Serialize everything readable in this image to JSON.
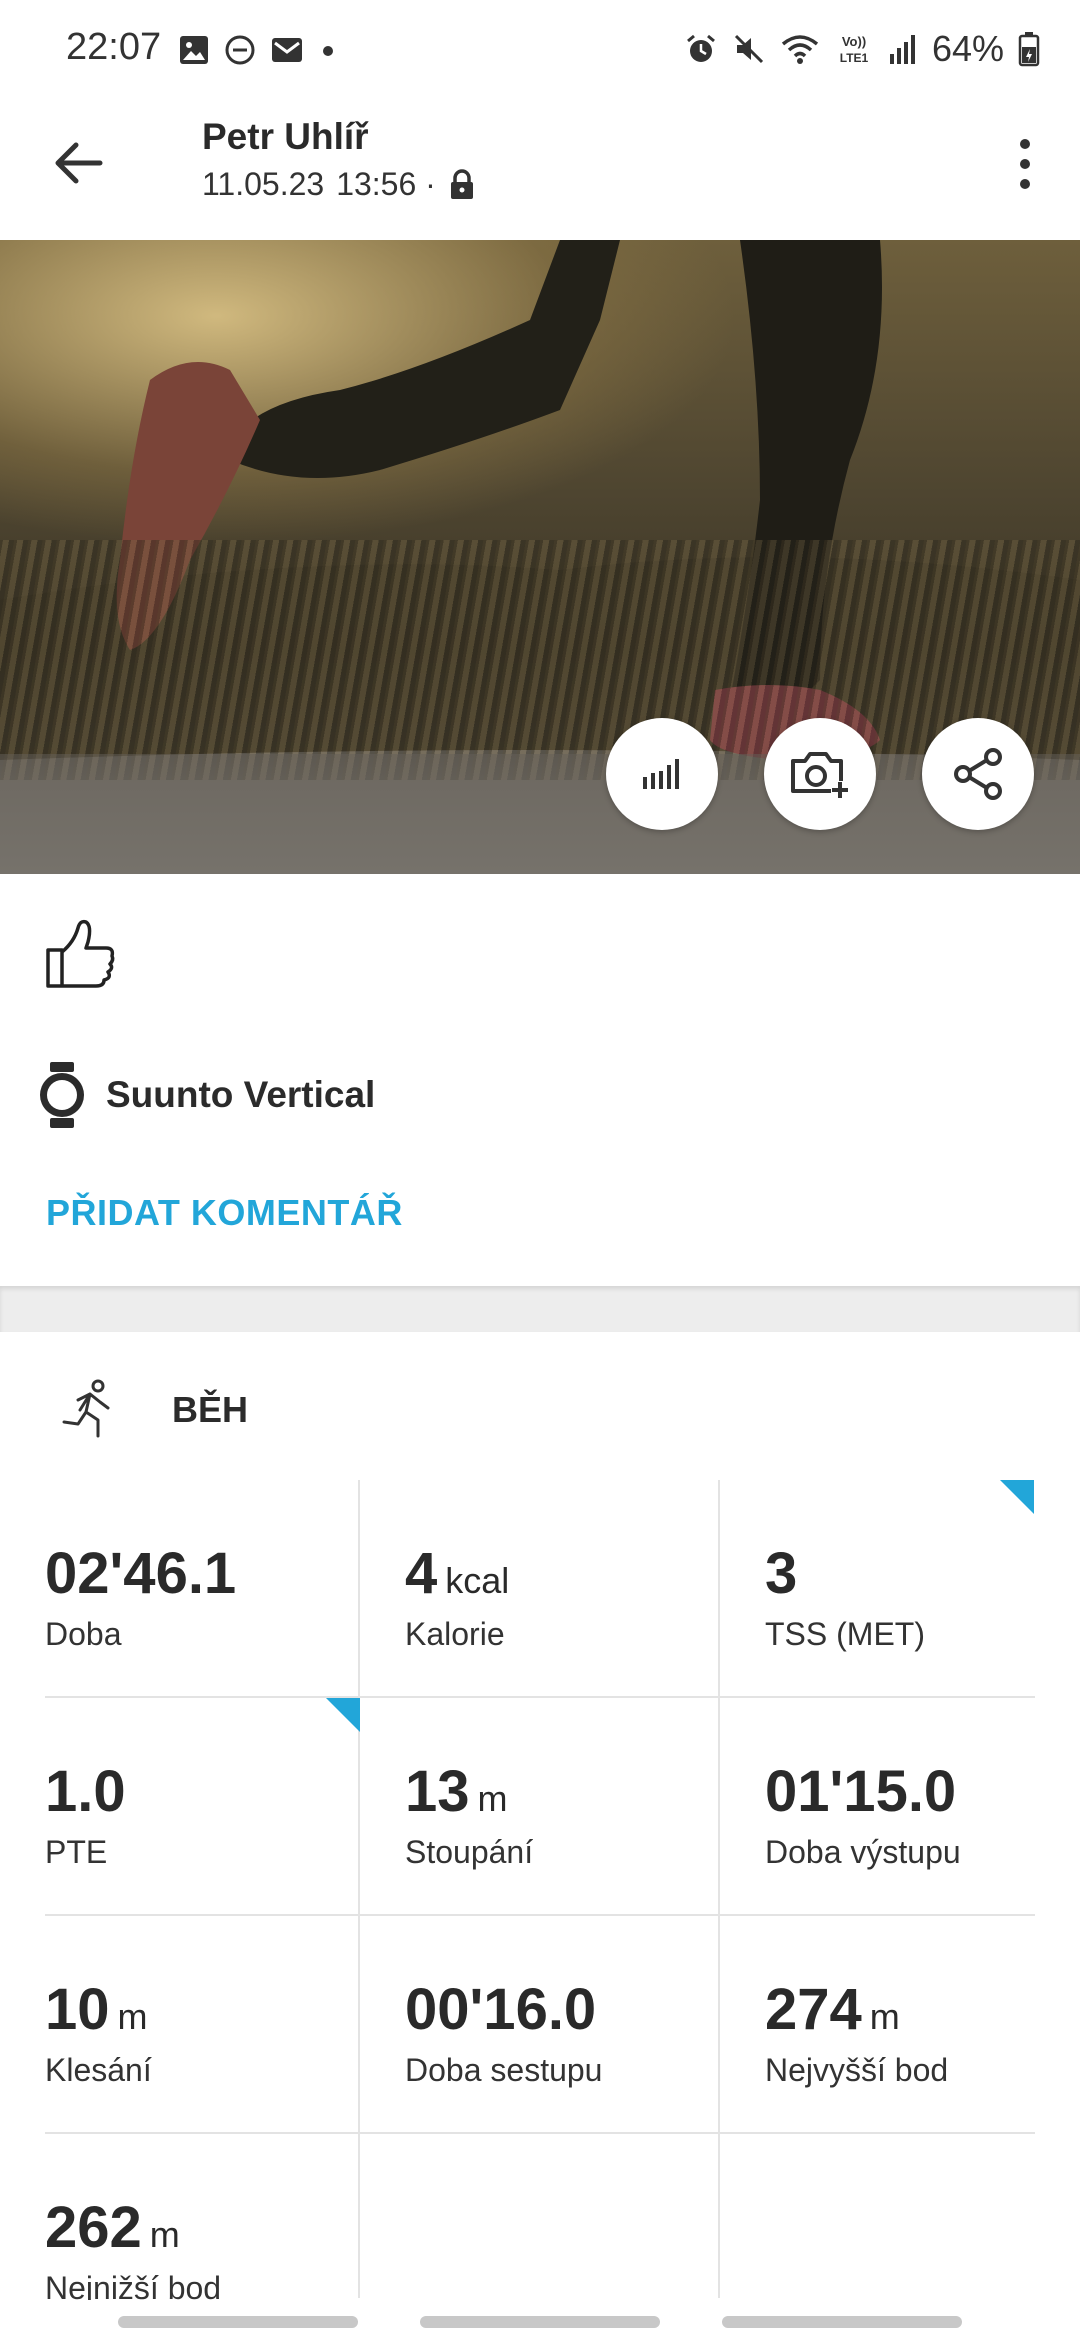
{
  "status_bar": {
    "time": "22:07",
    "battery": "64%",
    "left_icons": [
      "gallery-icon",
      "dnd-icon",
      "mail-icon",
      "dot-icon"
    ],
    "right_icons": [
      "alarm-icon",
      "mute-icon",
      "wifi-icon",
      "volte-icon",
      "signal-icon",
      "battery-icon"
    ]
  },
  "header": {
    "user_name": "Petr Uhlíř",
    "date": "11.05.23",
    "time": "13:56 ·"
  },
  "actions": [
    "chart-icon",
    "add-photo-icon",
    "share-icon"
  ],
  "device": {
    "name": "Suunto Vertical"
  },
  "add_comment": "PŘIDAT KOMENTÁŘ",
  "activity": {
    "type": "BĚH"
  },
  "stats": [
    {
      "value": "02'46.1",
      "unit": "",
      "label": "Doba"
    },
    {
      "value": "4",
      "unit": "kcal",
      "label": "Kalorie"
    },
    {
      "value": "3",
      "unit": "",
      "label": "TSS (MET)"
    },
    {
      "value": "1.0",
      "unit": "",
      "label": "PTE"
    },
    {
      "value": "13",
      "unit": "m",
      "label": "Stoupání"
    },
    {
      "value": "01'15.0",
      "unit": "",
      "label": "Doba výstupu"
    },
    {
      "value": "10",
      "unit": "m",
      "label": "Klesání"
    },
    {
      "value": "00'16.0",
      "unit": "",
      "label": "Doba sestupu"
    },
    {
      "value": "274",
      "unit": "m",
      "label": "Nejvyšší bod"
    },
    {
      "value": "262",
      "unit": "m",
      "label": "Nejnižší bod"
    }
  ],
  "colors": {
    "accent": "#22a6d9"
  }
}
